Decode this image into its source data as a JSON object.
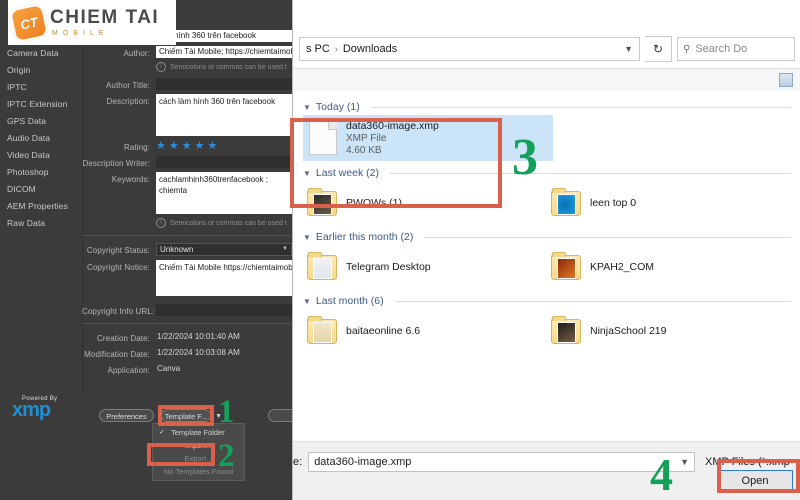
{
  "watermark": {
    "brand": "CHIEM TAI",
    "sub": "MOBILE",
    "mark": "CT"
  },
  "xmp_panel": {
    "nav_items": [
      "Camera Data",
      "Origin",
      "IPTC",
      "IPTC Extension",
      "GPS Data",
      "Audio Data",
      "Video Data",
      "Photoshop",
      "DICOM",
      "AEM Properties",
      "Raw Data"
    ],
    "fields": {
      "document_title_value": "làm hình 360 trên facebook",
      "author_label": "Author:",
      "author_value": "Chiếm Tài Mobile; https://chiemtaimob",
      "author_hint": "Semicolons or commas can be used t",
      "author_title_label": "Author Title:",
      "author_title_value": "",
      "description_label": "Description:",
      "description_value": "cách làm hình 360 trên facebook",
      "rating_label": "Rating:",
      "rating_value": 5,
      "description_writer_label": "Description Writer:",
      "description_writer_value": "",
      "keywords_label": "Keywords:",
      "keywords_value": "cachlamhinh360trenfacebook ; chiemta",
      "keywords_hint": "Semicolons or commas can be used t",
      "copyright_status_label": "Copyright Status:",
      "copyright_status_value": "Unknown",
      "copyright_notice_label": "Copyright Notice:",
      "copyright_notice_value": "Chiếm Tài Mobile https://chiemtaimobi",
      "copyright_url_label": "Copyright Info URL:",
      "copyright_url_value": "",
      "creation_date_label": "Creation Date:",
      "creation_date_value": "1/22/2024 10:01:40 AM",
      "modification_date_label": "Modification Date:",
      "modification_date_value": "1/22/2024 10:03:08 AM",
      "application_label": "Application:",
      "application_value": "Canva"
    },
    "powered_by": {
      "label": "Powered By",
      "name": "xmp"
    },
    "buttons": {
      "preferences": "Preferences",
      "template": "Template F...",
      "right_pill": ""
    },
    "template_menu": [
      {
        "label": "Template Folder",
        "checked": true,
        "disabled": false
      },
      {
        "label": "Import...",
        "checked": false,
        "disabled": false
      },
      {
        "label": "Export...",
        "checked": false,
        "disabled": true
      },
      {
        "label": "No Templates Found",
        "checked": false,
        "disabled": true
      }
    ]
  },
  "dialog": {
    "breadcrumb": {
      "root": "s PC",
      "sep": "›",
      "current": "Downloads"
    },
    "refresh_icon": "↻",
    "search": {
      "icon": "⚲",
      "placeholder": "Search Do"
    },
    "groups": [
      {
        "header": "Today (1)",
        "items": [
          {
            "name": "data360-image.xmp",
            "type": "XMP File",
            "size": "4.60 KB",
            "kind": "file",
            "selected": true
          }
        ]
      },
      {
        "header": "Last week (2)",
        "items": [
          {
            "name": "PWOWs (1)",
            "kind": "folder",
            "thumb": "t-dark",
            "selected": false
          },
          {
            "name": "leen top 0",
            "kind": "folder",
            "thumb": "t-edge",
            "selected": false
          }
        ]
      },
      {
        "header": "Earlier this month (2)",
        "items": [
          {
            "name": "Telegram Desktop",
            "kind": "folder",
            "thumb": "t-tg",
            "selected": false
          },
          {
            "name": "KPAH2_COM",
            "kind": "folder",
            "thumb": "t-fire",
            "selected": false
          }
        ]
      },
      {
        "header": "Last month (6)",
        "items": [
          {
            "name": "baitaeonline 6.6",
            "kind": "folder",
            "thumb": "t-pale",
            "selected": false
          },
          {
            "name": "NinjaSchool 219",
            "kind": "folder",
            "thumb": "t-ninja",
            "selected": false
          }
        ]
      }
    ],
    "bottom": {
      "filename_label": "e:",
      "filename_value": "data360-image.xmp",
      "filter_value": "XMP Files (*.xmp",
      "open_button": "Open"
    }
  },
  "annotations": {
    "steps": [
      "1",
      "2",
      "3",
      "4"
    ],
    "box_color": "#d9604a",
    "number_color": "#14a05a"
  }
}
